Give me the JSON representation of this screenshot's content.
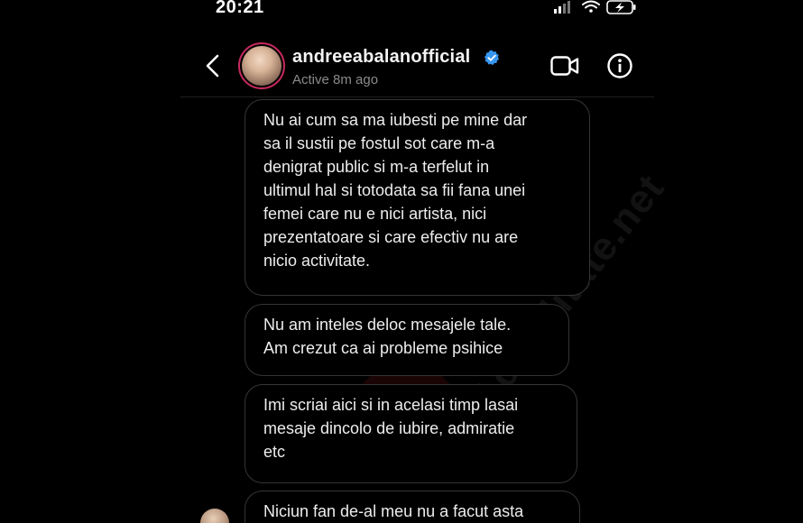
{
  "status_bar": {
    "time": "20:21"
  },
  "header": {
    "username": "andreeabalanofficial",
    "activity": "Active 8m ago"
  },
  "messages": [
    {
      "lines": [
        "Nu ai cum sa ma iubesti pe mine dar",
        "sa il sustii pe fostul sot care m-a",
        "denigrat public si m-a terfelut in",
        "ultimul hal si totodata sa fii fana unei",
        "femei care nu e nici artista, nici",
        "prezentatoare si care efectiv nu are",
        "nicio activitate."
      ]
    },
    {
      "lines": [
        "Nu am inteles deloc mesajele tale.",
        "Am crezut ca ai probleme psihice"
      ]
    },
    {
      "lines": [
        "Imi scriai aici si in acelasi timp lasai",
        "mesaje dincolo de iubire, admiratie",
        "etc"
      ]
    },
    {
      "lines": [
        "Niciun fan de-al meu nu a facut asta"
      ]
    }
  ],
  "watermark": {
    "text": "Actualitate.net"
  },
  "colors": {
    "background": "#000000",
    "bubble_border": "#353535",
    "verified": "#3797f0",
    "avatar_ring": "#c62a5c"
  },
  "icons": [
    "back-chevron-icon",
    "verified-badge-icon",
    "video-call-icon",
    "info-icon",
    "signal-icon",
    "wifi-icon",
    "battery-charging-icon"
  ]
}
